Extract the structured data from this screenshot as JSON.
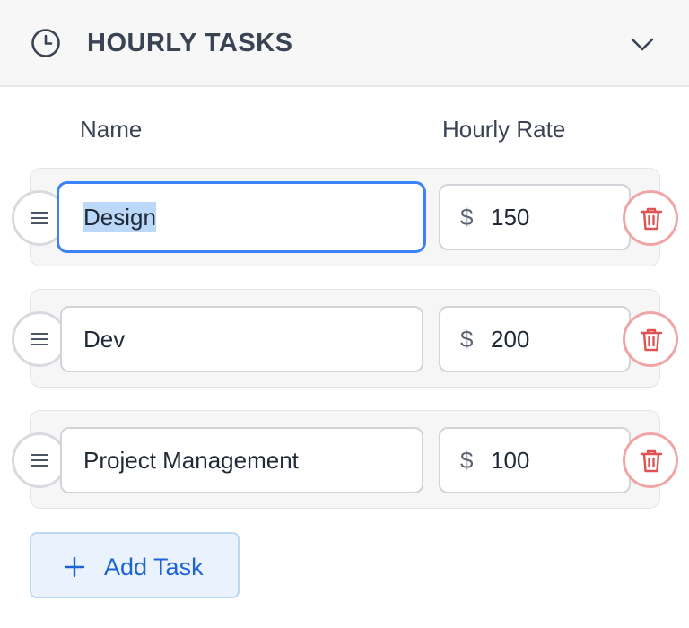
{
  "panel": {
    "title": "HOURLY TASKS",
    "icon": "clock-icon",
    "toggle_icon": "chevron-down-icon"
  },
  "columns": {
    "name": "Name",
    "rate": "Hourly Rate"
  },
  "tasks": [
    {
      "name": "Design",
      "currency": "$",
      "rate": "150",
      "focused": true,
      "text_selected": true
    },
    {
      "name": "Dev",
      "currency": "$",
      "rate": "200",
      "focused": false,
      "text_selected": false
    },
    {
      "name": "Project Management",
      "currency": "$",
      "rate": "100",
      "focused": false,
      "text_selected": false
    }
  ],
  "add_button": {
    "label": "Add Task",
    "icon": "plus-icon"
  },
  "colors": {
    "header_bg": "#f7f7f8",
    "focus_border": "#3b82f6",
    "selection": "#bcd8f8",
    "delete": "#e05252",
    "delete_border": "#f0a6a6",
    "accent": "#1e63d5",
    "accent_bg": "#eaf3fd"
  }
}
